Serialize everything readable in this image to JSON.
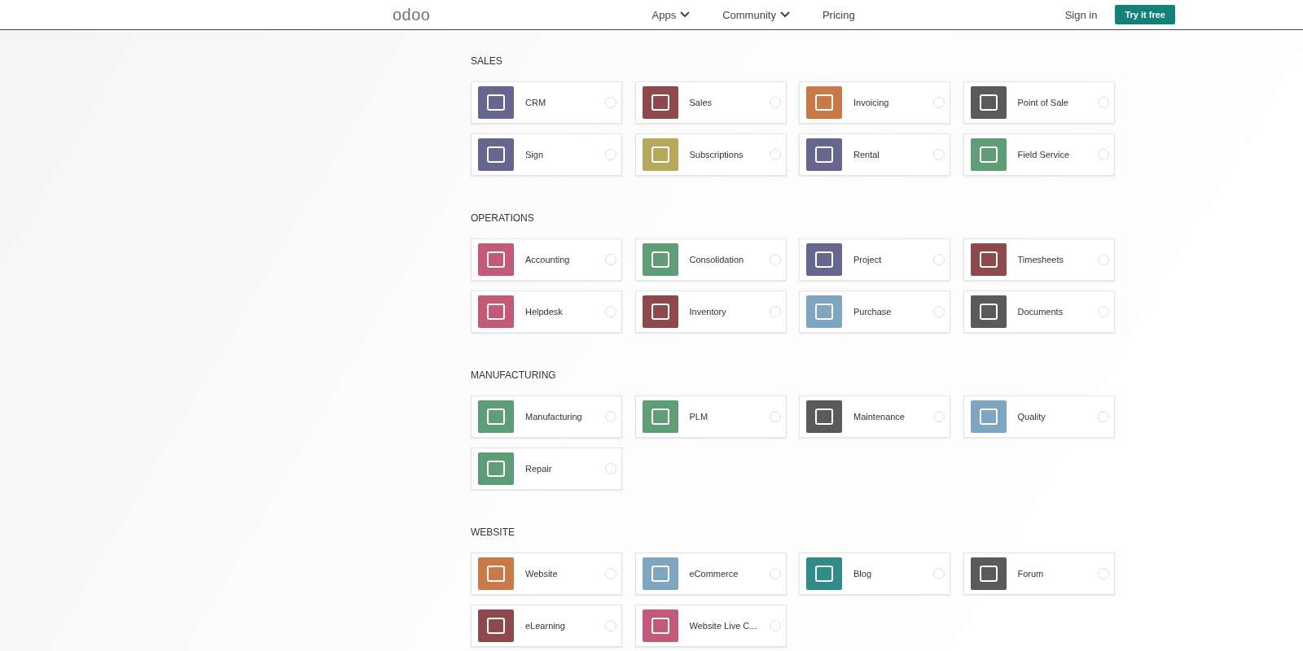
{
  "header": {
    "logo": "odoo",
    "nav": [
      {
        "label": "Apps",
        "dropdown": true
      },
      {
        "label": "Community",
        "dropdown": true
      },
      {
        "label": "Pricing",
        "dropdown": false
      }
    ],
    "sign_in": "Sign in",
    "cta": "Try it free"
  },
  "sections": [
    {
      "title": "SALES",
      "apps": [
        {
          "name": "CRM",
          "color": "#66668f",
          "selected": false
        },
        {
          "name": "Sales",
          "color": "#8e4a4a",
          "selected": false
        },
        {
          "name": "Invoicing",
          "color": "#c97a48",
          "selected": false
        },
        {
          "name": "Point of Sale",
          "color": "#5a5a5a",
          "selected": false
        },
        {
          "name": "Sign",
          "color": "#66668f",
          "selected": false
        },
        {
          "name": "Subscriptions",
          "color": "#b7a95c",
          "selected": false
        },
        {
          "name": "Rental",
          "color": "#66668f",
          "selected": false
        },
        {
          "name": "Field Service",
          "color": "#5f9d77",
          "selected": false
        }
      ]
    },
    {
      "title": "OPERATIONS",
      "apps": [
        {
          "name": "Accounting",
          "color": "#c25a78",
          "selected": false
        },
        {
          "name": "Consolidation",
          "color": "#5f9d77",
          "selected": false
        },
        {
          "name": "Project",
          "color": "#66668f",
          "selected": false
        },
        {
          "name": "Timesheets",
          "color": "#8e4a4a",
          "selected": false
        },
        {
          "name": "Helpdesk",
          "color": "#c25a78",
          "selected": false
        },
        {
          "name": "Inventory",
          "color": "#8e4a4a",
          "selected": false
        },
        {
          "name": "Purchase",
          "color": "#7ea6c0",
          "selected": false
        },
        {
          "name": "Documents",
          "color": "#5a5a5a",
          "selected": false
        }
      ]
    },
    {
      "title": "MANUFACTURING",
      "apps": [
        {
          "name": "Manufacturing",
          "color": "#5f9d77",
          "selected": false
        },
        {
          "name": "PLM",
          "color": "#5f9d77",
          "selected": false
        },
        {
          "name": "Maintenance",
          "color": "#5a5a5a",
          "selected": false
        },
        {
          "name": "Quality",
          "color": "#7ea6c0",
          "selected": false
        },
        {
          "name": "Repair",
          "color": "#5f9d77",
          "selected": false
        }
      ]
    },
    {
      "title": "WEBSITE",
      "apps": [
        {
          "name": "Website",
          "color": "#c97a48",
          "selected": false
        },
        {
          "name": "eCommerce",
          "color": "#7ea6c0",
          "selected": false
        },
        {
          "name": "Blog",
          "color": "#2f8c86",
          "selected": false
        },
        {
          "name": "Forum",
          "color": "#5a5a5a",
          "selected": false
        },
        {
          "name": "eLearning",
          "color": "#8e4a4a",
          "selected": false
        },
        {
          "name": "Website Live C...",
          "color": "#c25a78",
          "selected": false
        }
      ]
    }
  ]
}
